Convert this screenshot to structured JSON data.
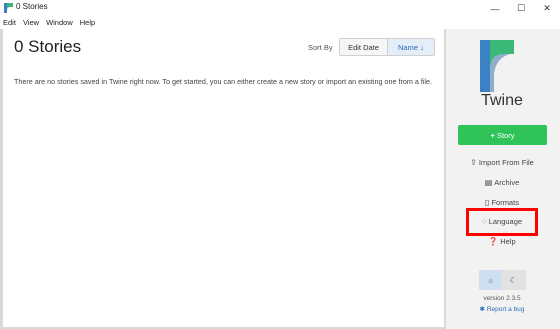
{
  "window": {
    "title": "0 Stories",
    "minimize": "—",
    "maximize": "☐",
    "close": "✕"
  },
  "menu": [
    "Edit",
    "View",
    "Window",
    "Help"
  ],
  "main": {
    "title": "0 Stories",
    "sort_label": "Sort By",
    "sort_edit_date": "Edit Date",
    "sort_name": "Name",
    "empty_message": "There are no stories saved in Twine right now. To get started, you can either create a new story or import an existing one from a file."
  },
  "sidebar": {
    "brand": "Twine",
    "story_button": "Story",
    "import": "Import From File",
    "archive": "Archive",
    "formats": "Formats",
    "language": "Language",
    "help": "Help",
    "version": "version 2.3.5",
    "report_bug": "Report a bug"
  },
  "colors": {
    "accent_green": "#2fc35a",
    "link_blue": "#2a6db5",
    "highlight_red": "#ff0000",
    "logo_blue": "#3b82c4",
    "logo_green": "#3cb878"
  },
  "icons": {
    "app": "twine-logo-icon",
    "sort": "sort-alpha-icon",
    "import": "upload-icon",
    "archive": "archive-icon",
    "formats": "file-icon",
    "language": "speech-bubble-icon",
    "help": "question-circle-icon",
    "light_theme": "sun-icon",
    "dark_theme": "moon-icon",
    "bug": "bug-icon"
  }
}
